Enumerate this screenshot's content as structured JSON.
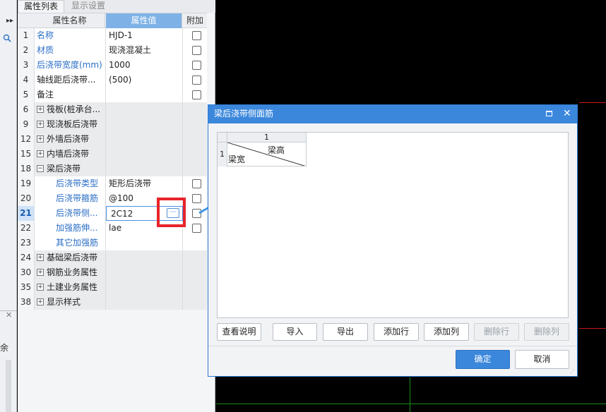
{
  "tabs": {
    "property_list": "属性列表",
    "display_settings": "显示设置"
  },
  "grid_header": {
    "name": "属性名称",
    "value": "属性值",
    "extra": "附加"
  },
  "rows": [
    {
      "num": "1",
      "name": "名称",
      "value": "HJD-1",
      "check": true
    },
    {
      "num": "2",
      "name": "材质",
      "value": "现浇混凝土",
      "check": true
    },
    {
      "num": "3",
      "name": "后浇带宽度(mm)",
      "value": "1000",
      "check": true
    },
    {
      "num": "4",
      "name": "轴线距后浇带...",
      "value": "(500)",
      "check": true
    },
    {
      "num": "5",
      "name": "备注",
      "value": "",
      "check": true
    },
    {
      "num": "6",
      "name": "筏板(桩承台...",
      "value": "",
      "check": false,
      "sign": "+"
    },
    {
      "num": "9",
      "name": "现浇板后浇带",
      "value": "",
      "check": false,
      "sign": "+"
    },
    {
      "num": "12",
      "name": "外墙后浇带",
      "value": "",
      "check": false,
      "sign": "+"
    },
    {
      "num": "15",
      "name": "内墙后浇带",
      "value": "",
      "check": false,
      "sign": "+"
    },
    {
      "num": "18",
      "name": "梁后浇带",
      "value": "",
      "check": false,
      "sign": "−"
    },
    {
      "num": "19",
      "name": "后浇带类型",
      "value": "矩形后浇带",
      "check": true
    },
    {
      "num": "20",
      "name": "后浇带箍筋",
      "value": "@100",
      "check": true
    },
    {
      "num": "21",
      "name": "后浇带侧...",
      "value": "2C12",
      "check": true
    },
    {
      "num": "22",
      "name": "加强筋伸...",
      "value": "lae",
      "check": true
    },
    {
      "num": "23",
      "name": "其它加强筋",
      "value": "",
      "check": false
    },
    {
      "num": "24",
      "name": "基础梁后浇带",
      "value": "",
      "check": false,
      "sign": "+"
    },
    {
      "num": "30",
      "name": "钢筋业务属性",
      "value": "",
      "check": false,
      "sign": "+"
    },
    {
      "num": "35",
      "name": "土建业务属性",
      "value": "",
      "check": false,
      "sign": "+"
    },
    {
      "num": "38",
      "name": "显示样式",
      "value": "",
      "check": false,
      "sign": "+"
    }
  ],
  "ellipsis_label": "···",
  "left_strip": {
    "partial_text": "余"
  },
  "dialog": {
    "title": "梁后浇带侧面筋",
    "table": {
      "col_header": "1",
      "row_header": "1",
      "top_right": "梁高",
      "bottom_left": "梁宽"
    },
    "buttons": [
      "查看说明",
      "导入",
      "导出",
      "添加行",
      "添加列",
      "删除行",
      "删除列"
    ],
    "ok": "确定",
    "cancel": "取消"
  }
}
